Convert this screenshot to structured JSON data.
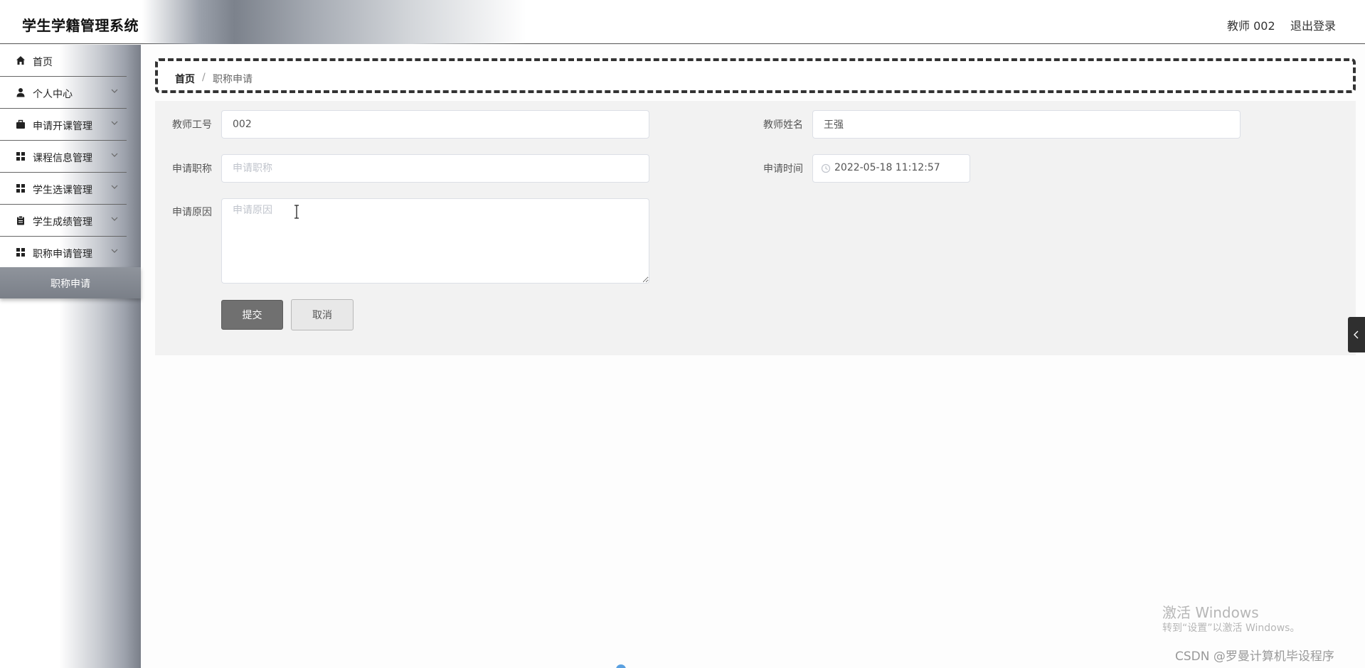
{
  "header": {
    "app_title": "学生学籍管理系统",
    "user": "教师 002",
    "logout": "退出登录"
  },
  "sidebar": {
    "items": [
      {
        "label": "首页",
        "icon": "home-icon",
        "has_children": false
      },
      {
        "label": "个人中心",
        "icon": "user-icon",
        "has_children": true
      },
      {
        "label": "申请开课管理",
        "icon": "briefcase-icon",
        "has_children": true
      },
      {
        "label": "课程信息管理",
        "icon": "grid-icon",
        "has_children": true
      },
      {
        "label": "学生选课管理",
        "icon": "grid-icon",
        "has_children": true
      },
      {
        "label": "学生成绩管理",
        "icon": "clipboard-icon",
        "has_children": true
      },
      {
        "label": "职称申请管理",
        "icon": "grid-icon",
        "has_children": true
      }
    ],
    "active_sub": {
      "label": "职称申请"
    }
  },
  "breadcrumb": {
    "home": "首页",
    "separator": "/",
    "current": "职称申请"
  },
  "form": {
    "teacher_id": {
      "label": "教师工号",
      "value": "002"
    },
    "teacher_name": {
      "label": "教师姓名",
      "value": "王强"
    },
    "title": {
      "label": "申请职称",
      "value": "",
      "placeholder": "申请职称"
    },
    "time": {
      "label": "申请时间",
      "value": "2022-05-18 11:12:57"
    },
    "reason": {
      "label": "申请原因",
      "value": "",
      "placeholder": "申请原因"
    },
    "submit": "提交",
    "cancel": "取消"
  },
  "watermark": {
    "title": "激活 Windows",
    "subtitle": "转到“设置”以激活 Windows。",
    "csdn": "CSDN @罗曼计算机毕设程序"
  }
}
